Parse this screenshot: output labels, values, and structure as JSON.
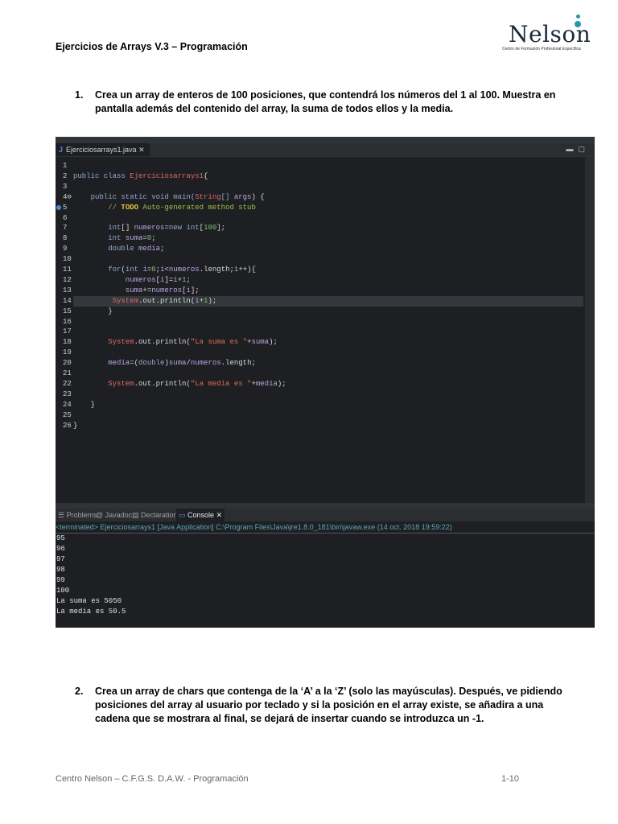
{
  "header": {
    "title": "Ejercicios  de Arrays V.3 – Programación"
  },
  "logo": {
    "word": "Nelson",
    "subtitle": "Centro de Formación Profesional Específica"
  },
  "exercises": [
    {
      "number": "1.",
      "text": "Crea un array de enteros de 100 posiciones, que contendrá los números del 1 al 100. Muestra en pantalla además del contenido del array, la suma de todos ellos y la media."
    },
    {
      "number": "2.",
      "text": "Crea un array de chars que contenga de la ‘A’ a la ‘Z’ (solo las mayúsculas). Después, ve pidiendo posiciones del array al usuario por teclado y si la posición en el array existe, se añadira a una cadena que se mostrara al final, se dejará de insertar cuando se introduzca un -1."
    }
  ],
  "ide": {
    "editor_tab": "Ejerciciosarrays1.java",
    "code_lines": [
      [
        [
          "",
          ""
        ]
      ],
      [
        [
          "k",
          "public class "
        ],
        [
          "cn",
          "Ejerciciosarrays1"
        ],
        [
          "",
          "{"
        ]
      ],
      [
        [
          "",
          ""
        ]
      ],
      [
        [
          "k",
          "    public static void main("
        ],
        [
          "cn",
          "String"
        ],
        [
          "k",
          "[] "
        ],
        [
          "v",
          "args"
        ],
        [
          "",
          ") {"
        ]
      ],
      [
        [
          "cm",
          "        // "
        ],
        [
          "td",
          "TODO"
        ],
        [
          "cm",
          " Auto-generated method stub"
        ]
      ],
      [
        [
          "",
          ""
        ]
      ],
      [
        [
          "k",
          "        int"
        ],
        [
          "",
          "[] "
        ],
        [
          "v",
          "numeros"
        ],
        [
          "",
          "="
        ],
        [
          "k",
          "new int"
        ],
        [
          "",
          "["
        ],
        [
          "n",
          "100"
        ],
        [
          "",
          "];"
        ]
      ],
      [
        [
          "k",
          "        int "
        ],
        [
          "v",
          "suma"
        ],
        [
          "",
          "="
        ],
        [
          "n",
          "0"
        ],
        [
          "",
          ";"
        ]
      ],
      [
        [
          "k",
          "        double "
        ],
        [
          "v",
          "media"
        ],
        [
          "",
          ";"
        ]
      ],
      [
        [
          "",
          ""
        ]
      ],
      [
        [
          "k",
          "        for"
        ],
        [
          "",
          "("
        ],
        [
          "k",
          "int "
        ],
        [
          "v",
          "i"
        ],
        [
          "",
          "="
        ],
        [
          "n",
          "0"
        ],
        [
          "",
          ";"
        ],
        [
          "v",
          "i"
        ],
        [
          "",
          "<"
        ],
        [
          "v",
          "numeros"
        ],
        [
          "",
          ".length;"
        ],
        [
          "v",
          "i"
        ],
        [
          "",
          "++){"
        ]
      ],
      [
        [
          "v",
          "            numeros"
        ],
        [
          "",
          "["
        ],
        [
          "v",
          "i"
        ],
        [
          "",
          "]="
        ],
        [
          "v",
          "i"
        ],
        [
          "",
          "+"
        ],
        [
          "n",
          "1"
        ],
        [
          "",
          ";"
        ]
      ],
      [
        [
          "v",
          "            suma"
        ],
        [
          "",
          "+="
        ],
        [
          "v",
          "numeros"
        ],
        [
          "",
          "["
        ],
        [
          "v",
          "i"
        ],
        [
          "",
          "];"
        ]
      ],
      [
        [
          "f",
          "         System"
        ],
        [
          "",
          ".out.println("
        ],
        [
          "v",
          "i"
        ],
        [
          "",
          "+"
        ],
        [
          "n",
          "1"
        ],
        [
          "",
          ");"
        ]
      ],
      [
        [
          "",
          "        }"
        ]
      ],
      [
        [
          "",
          ""
        ]
      ],
      [
        [
          "",
          ""
        ]
      ],
      [
        [
          "f",
          "        System"
        ],
        [
          "",
          ".out.println("
        ],
        [
          "s",
          "\"La suma es \""
        ],
        [
          "",
          "+"
        ],
        [
          "v",
          "suma"
        ],
        [
          "",
          ");"
        ]
      ],
      [
        [
          "",
          ""
        ]
      ],
      [
        [
          "v",
          "        media"
        ],
        [
          "",
          "=("
        ],
        [
          "k",
          "double"
        ],
        [
          "",
          ")"
        ],
        [
          "v",
          "suma"
        ],
        [
          "",
          "/"
        ],
        [
          "v",
          "numeros"
        ],
        [
          "",
          ".length;"
        ]
      ],
      [
        [
          "",
          ""
        ]
      ],
      [
        [
          "f",
          "        System"
        ],
        [
          "",
          ".out.println("
        ],
        [
          "s",
          "\"La media es \""
        ],
        [
          "",
          "+"
        ],
        [
          "v",
          "media"
        ],
        [
          "",
          ");"
        ]
      ],
      [
        [
          "",
          ""
        ]
      ],
      [
        [
          "",
          "    }"
        ]
      ],
      [
        [
          "",
          ""
        ]
      ],
      [
        [
          "",
          "}"
        ]
      ]
    ],
    "panel_tabs": [
      "Problems",
      "@ Javadoc",
      "Declaration",
      "Console"
    ],
    "terminated": "<terminated> Ejerciciosarrays1 [Java Application] C:\\Program Files\\Java\\jre1.8.0_181\\bin\\javaw.exe (14 oct. 2018 19:59:22)",
    "console_output": [
      "95",
      "96",
      "97",
      "98",
      "99",
      "100",
      "La suma es 5050",
      "La media es 50.5"
    ]
  },
  "footer": {
    "left": "Centro Nelson – C.F.G.S.  D.A.W. - Programación",
    "right": "1-10"
  }
}
